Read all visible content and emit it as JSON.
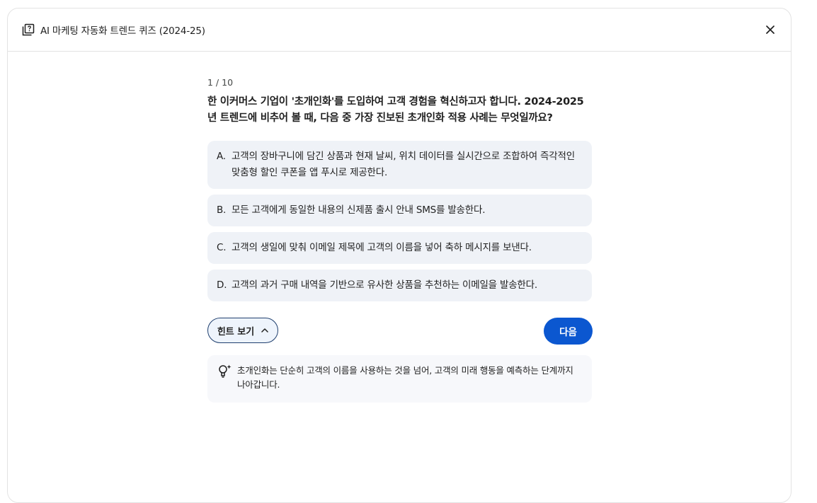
{
  "header": {
    "title": "AI 마케팅 자동화 트렌드 퀴즈 (2024-25)",
    "icon": "quiz-icon",
    "close_icon": "close-icon"
  },
  "quiz": {
    "counter": "1 / 10",
    "question": "한 이커머스 기업이 '초개인화'를 도입하여 고객 경험을 혁신하고자 합니다. 2024-2025년 트렌드에 비추어 볼 때, 다음 중 가장 진보된 초개인화 적용 사례는 무엇일까요?",
    "options": [
      {
        "letter": "A.",
        "text": "고객의 장바구니에 담긴 상품과 현재 날씨, 위치 데이터를 실시간으로 조합하여 즉각적인 맞춤형 할인 쿠폰을 앱 푸시로 제공한다."
      },
      {
        "letter": "B.",
        "text": "모든 고객에게 동일한 내용의 신제품 출시 안내 SMS를 발송한다."
      },
      {
        "letter": "C.",
        "text": "고객의 생일에 맞춰 이메일 제목에 고객의 이름을 넣어 축하 메시지를 보낸다."
      },
      {
        "letter": "D.",
        "text": "고객의 과거 구매 내역을 기반으로 유사한 상품을 추천하는 이메일을 발송한다."
      }
    ]
  },
  "actions": {
    "hint_label": "힌트 보기",
    "next_label": "다음"
  },
  "hint": {
    "icon": "lightbulb-icon",
    "text": "초개인화는 단순히 고객의 이름을 사용하는 것을 넘어, 고객의 미래 행동을 예측하는 단계까지 나아갑니다."
  },
  "colors": {
    "primary": "#0b57d0",
    "option_bg": "#eff2f7",
    "hint_bg": "#f7f8fb"
  }
}
